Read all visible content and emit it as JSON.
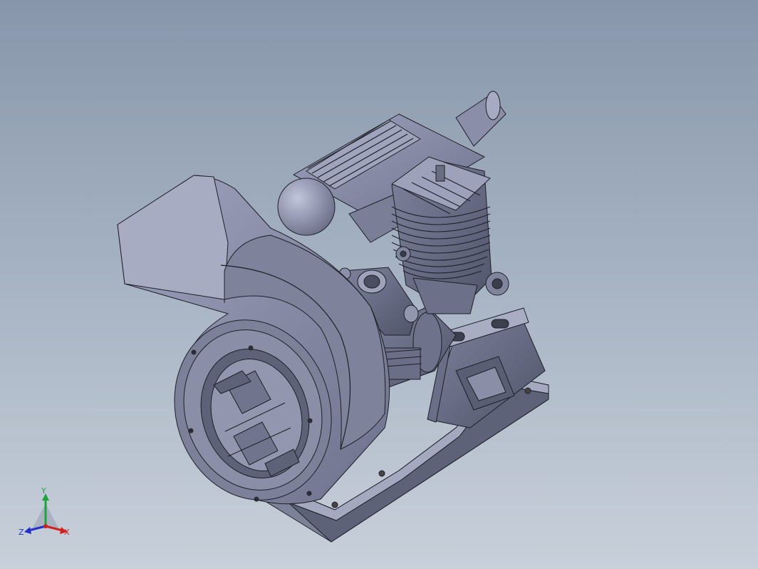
{
  "viewport": {
    "background_top": "#8796aa",
    "background_bottom": "#c8d0da",
    "model_color": "#8a8ea8",
    "edge_color": "#1e1f28"
  },
  "triad": {
    "x_label": "X",
    "y_label": "Y",
    "z_label": "Z",
    "x_color": "#d0201c",
    "y_color": "#1ea43a",
    "z_color": "#2030c8"
  }
}
